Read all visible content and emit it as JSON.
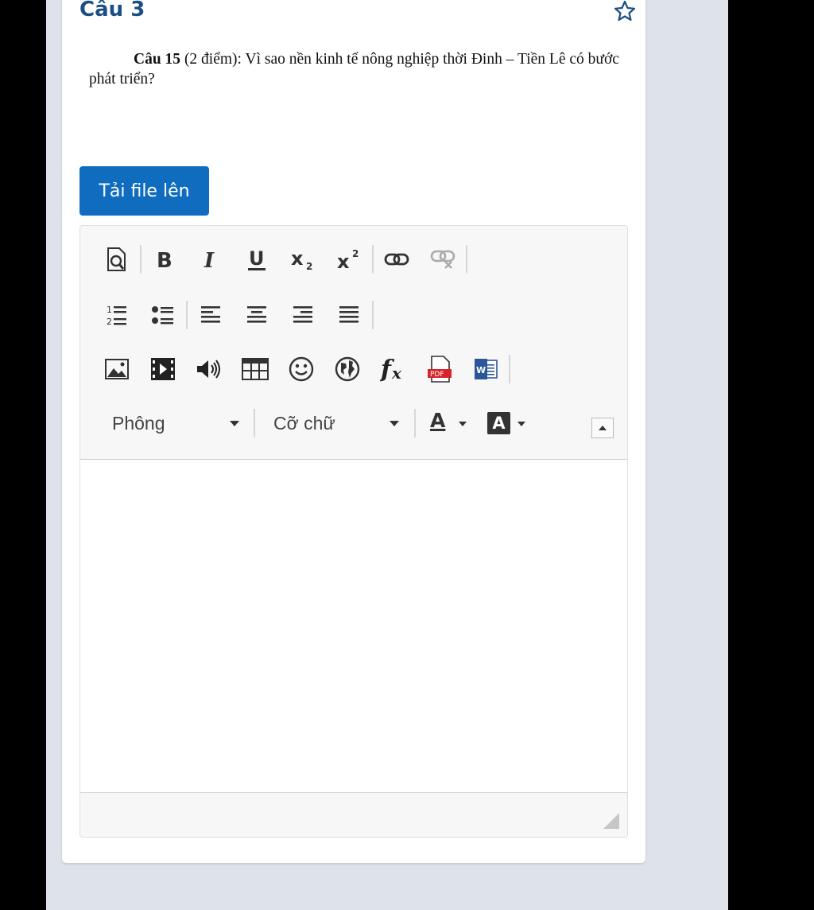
{
  "question": {
    "title": "Câu 3",
    "text_bold": "Câu 15",
    "text_rest": " (2 điểm): Vì sao nền kinh tế nông nghiệp thời Đinh – Tiền Lê có bước phát triển?"
  },
  "upload": {
    "label": "Tải file lên"
  },
  "editor": {
    "font_select": "Phông",
    "size_select": "Cỡ chữ",
    "text_color_glyph": "A",
    "bg_color_glyph": "A"
  },
  "colors": {
    "accent": "#0f6cbf",
    "title": "#1b4f84",
    "page_bg": "#dee2eb"
  },
  "icons": {
    "row1": [
      "preview-icon",
      "bold-icon",
      "italic-icon",
      "underline-icon",
      "subscript-icon",
      "superscript-icon",
      "link-icon",
      "unlink-icon"
    ],
    "row2": [
      "ordered-list-icon",
      "unordered-list-icon",
      "align-left-icon",
      "align-center-icon",
      "align-right-icon",
      "align-justify-icon"
    ],
    "row3": [
      "image-icon",
      "video-icon",
      "audio-icon",
      "table-icon",
      "emoticon-icon",
      "globe-icon",
      "equation-icon",
      "pdf-icon",
      "word-icon"
    ]
  }
}
